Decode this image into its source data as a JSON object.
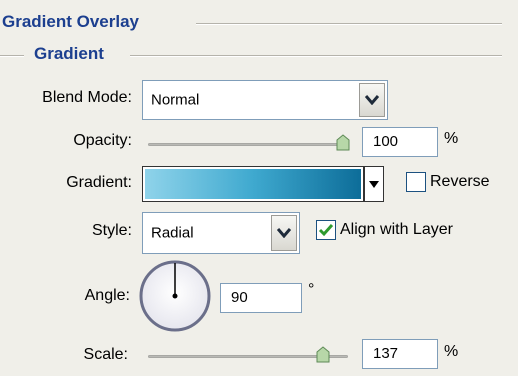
{
  "panel": {
    "title": "Gradient Overlay",
    "subtitle": "Gradient"
  },
  "blend_mode": {
    "label": "Blend Mode:",
    "value": "Normal"
  },
  "opacity": {
    "label": "Opacity:",
    "value": "100",
    "unit": "%",
    "level": 1.0
  },
  "gradient": {
    "label": "Gradient:",
    "colors": [
      "#8fd3ea",
      "#3fa9cf",
      "#0d6d99"
    ],
    "reverse": {
      "label": "Reverse",
      "checked": false
    }
  },
  "style": {
    "label": "Style:",
    "value": "Radial"
  },
  "align_with_layer": {
    "label": "Align with Layer",
    "checked": true
  },
  "angle": {
    "label": "Angle:",
    "value": "90",
    "unit": "°"
  },
  "scale": {
    "label": "Scale:",
    "value": "137",
    "unit": "%",
    "level": 0.91
  },
  "colors": {
    "title": "#1c3f8f",
    "check": "#2e9a2e",
    "border": "#7f9db9"
  }
}
